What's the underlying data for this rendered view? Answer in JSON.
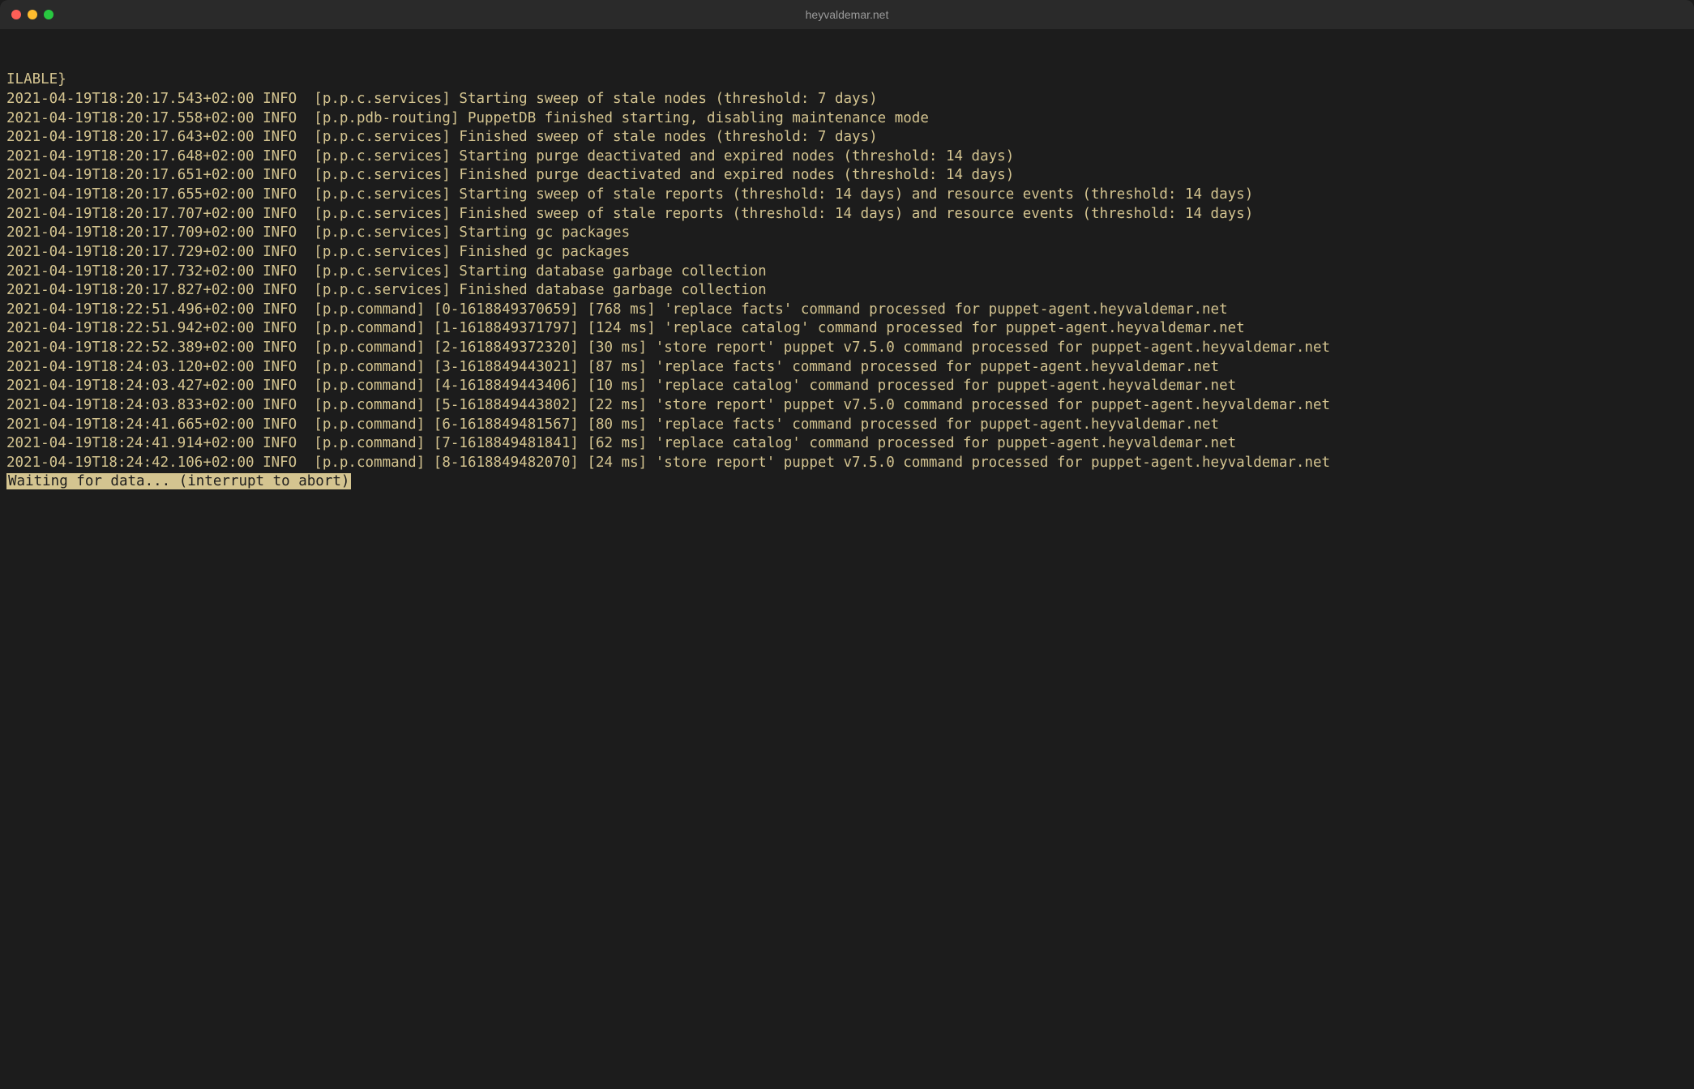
{
  "window": {
    "title": "heyvaldemar.net"
  },
  "terminal": {
    "first_line": "ILABLE}",
    "log_lines": [
      "2021-04-19T18:20:17.543+02:00 INFO  [p.p.c.services] Starting sweep of stale nodes (threshold: 7 days)",
      "2021-04-19T18:20:17.558+02:00 INFO  [p.p.pdb-routing] PuppetDB finished starting, disabling maintenance mode",
      "2021-04-19T18:20:17.643+02:00 INFO  [p.p.c.services] Finished sweep of stale nodes (threshold: 7 days)",
      "2021-04-19T18:20:17.648+02:00 INFO  [p.p.c.services] Starting purge deactivated and expired nodes (threshold: 14 days)",
      "2021-04-19T18:20:17.651+02:00 INFO  [p.p.c.services] Finished purge deactivated and expired nodes (threshold: 14 days)",
      "2021-04-19T18:20:17.655+02:00 INFO  [p.p.c.services] Starting sweep of stale reports (threshold: 14 days) and resource events (threshold: 14 days)",
      "2021-04-19T18:20:17.707+02:00 INFO  [p.p.c.services] Finished sweep of stale reports (threshold: 14 days) and resource events (threshold: 14 days)",
      "2021-04-19T18:20:17.709+02:00 INFO  [p.p.c.services] Starting gc packages",
      "2021-04-19T18:20:17.729+02:00 INFO  [p.p.c.services] Finished gc packages",
      "2021-04-19T18:20:17.732+02:00 INFO  [p.p.c.services] Starting database garbage collection",
      "2021-04-19T18:20:17.827+02:00 INFO  [p.p.c.services] Finished database garbage collection",
      "2021-04-19T18:22:51.496+02:00 INFO  [p.p.command] [0-1618849370659] [768 ms] 'replace facts' command processed for puppet-agent.heyvaldemar.net",
      "2021-04-19T18:22:51.942+02:00 INFO  [p.p.command] [1-1618849371797] [124 ms] 'replace catalog' command processed for puppet-agent.heyvaldemar.net",
      "2021-04-19T18:22:52.389+02:00 INFO  [p.p.command] [2-1618849372320] [30 ms] 'store report' puppet v7.5.0 command processed for puppet-agent.heyvaldemar.net",
      "2021-04-19T18:24:03.120+02:00 INFO  [p.p.command] [3-1618849443021] [87 ms] 'replace facts' command processed for puppet-agent.heyvaldemar.net",
      "2021-04-19T18:24:03.427+02:00 INFO  [p.p.command] [4-1618849443406] [10 ms] 'replace catalog' command processed for puppet-agent.heyvaldemar.net",
      "2021-04-19T18:24:03.833+02:00 INFO  [p.p.command] [5-1618849443802] [22 ms] 'store report' puppet v7.5.0 command processed for puppet-agent.heyvaldemar.net",
      "2021-04-19T18:24:41.665+02:00 INFO  [p.p.command] [6-1618849481567] [80 ms] 'replace facts' command processed for puppet-agent.heyvaldemar.net",
      "2021-04-19T18:24:41.914+02:00 INFO  [p.p.command] [7-1618849481841] [62 ms] 'replace catalog' command processed for puppet-agent.heyvaldemar.net",
      "2021-04-19T18:24:42.106+02:00 INFO  [p.p.command] [8-1618849482070] [24 ms] 'store report' puppet v7.5.0 command processed for puppet-agent.heyvaldemar.net"
    ],
    "status_line": "Waiting for data... (interrupt to abort)"
  }
}
